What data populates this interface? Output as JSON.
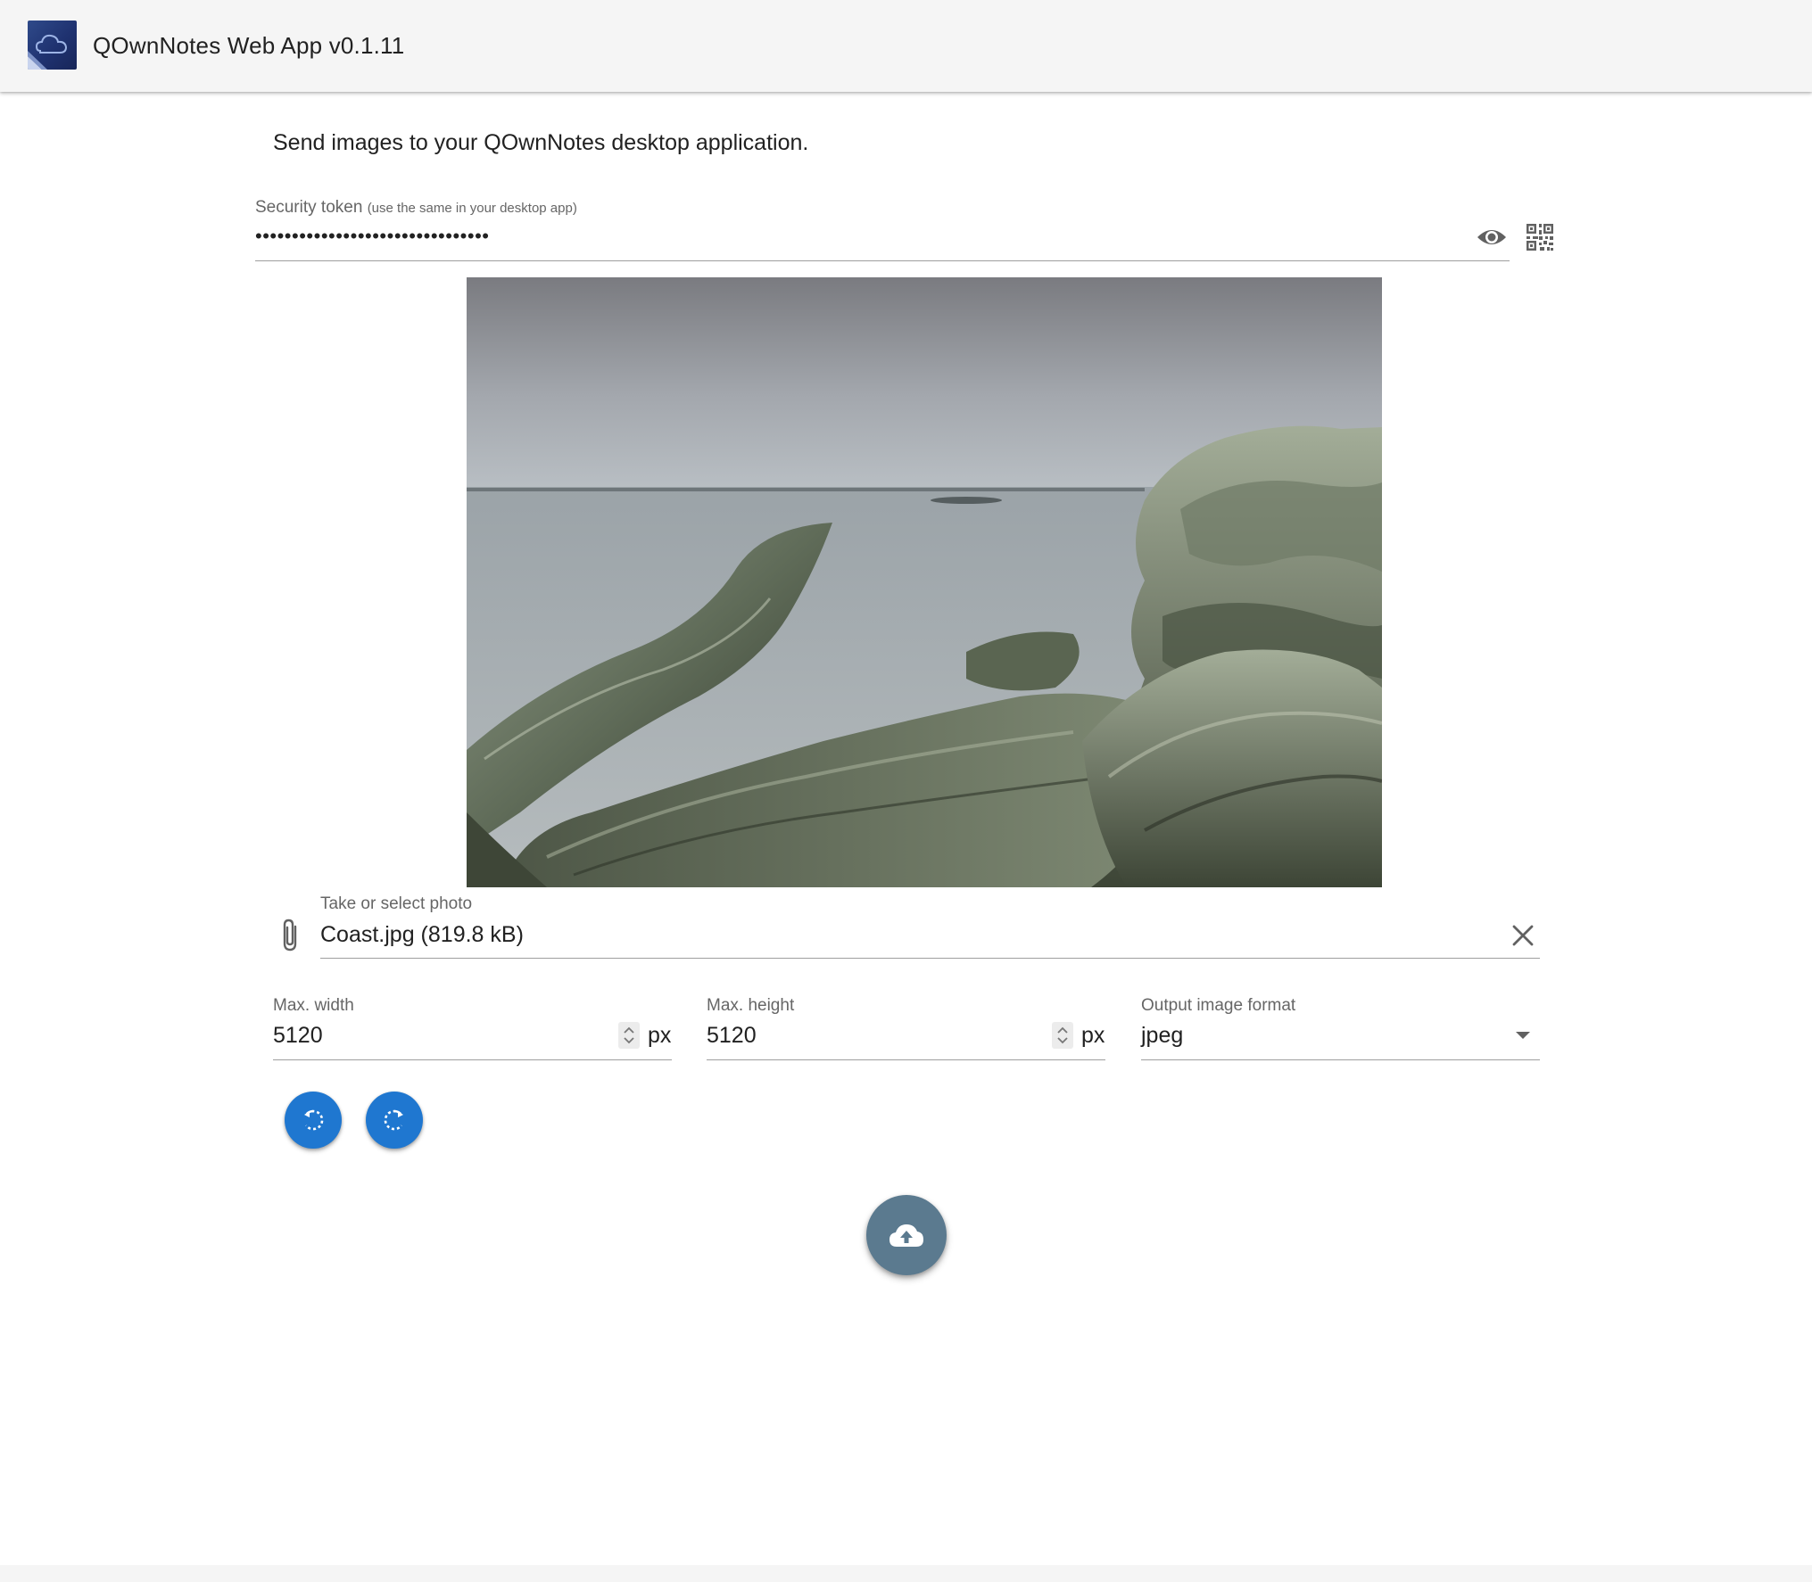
{
  "header": {
    "title": "QOwnNotes Web App v0.1.11",
    "logo_icon": "cloud-logo-icon"
  },
  "intro": "Send images to your QOwnNotes desktop application.",
  "token": {
    "label": "Security token",
    "hint": "(use the same in your desktop app)",
    "masked_value": "••••••••••••••••••••••••••••••••",
    "show_icon": "eye-icon",
    "qr_icon": "qr-code-icon"
  },
  "photo": {
    "alt": "Coast"
  },
  "file": {
    "label": "Take or select photo",
    "value": "Coast.jpg (819.8 kB)",
    "attach_icon": "paperclip-icon",
    "clear_icon": "close-icon"
  },
  "max_width": {
    "label": "Max. width",
    "value": "5120",
    "unit": "px"
  },
  "max_height": {
    "label": "Max. height",
    "value": "5120",
    "unit": "px"
  },
  "format": {
    "label": "Output image format",
    "value": "jpeg"
  },
  "actions": {
    "rotate_left_icon": "rotate-left-icon",
    "rotate_right_icon": "rotate-right-icon",
    "upload_icon": "cloud-upload-icon"
  },
  "colors": {
    "primary": "#1f77d0",
    "upload": "#5b7a8f",
    "appbar": "#f5f5f5"
  }
}
